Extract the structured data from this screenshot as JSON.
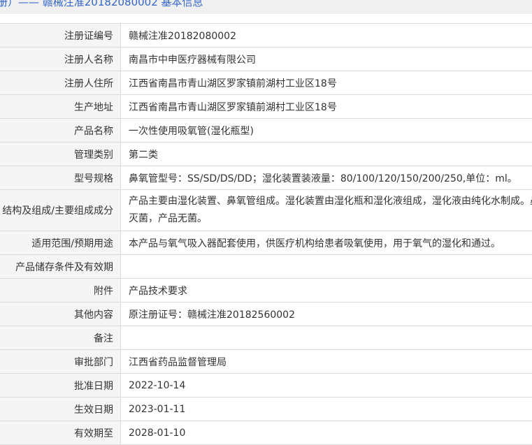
{
  "header": {
    "text": "册）——  赣械注准20182080002  基本信息"
  },
  "rows": [
    {
      "label": "注册证编号",
      "value": "赣械注准20182080002"
    },
    {
      "label": "注册人名称",
      "value": "南昌市中申医疗器械有限公司"
    },
    {
      "label": "注册人住所",
      "value": "江西省南昌市青山湖区罗家镇前湖村工业区18号"
    },
    {
      "label": "生产地址",
      "value": "江西省南昌市青山湖区罗家镇前湖村工业区18号"
    },
    {
      "label": "产品名称",
      "value": "一次性使用吸氧管(湿化瓶型)"
    },
    {
      "label": "管理类别",
      "value": "第二类"
    },
    {
      "label": "型号规格",
      "value": "鼻氧管型号：SS/SD/DS/DD；湿化装置装液量：80/100/120/150/200/250,单位：ml。"
    },
    {
      "label": "结构及组成/主要组成成分",
      "value": "产品主要由湿化装置、鼻氧管组成。湿化装置由湿化瓶和湿化液组成，湿化液由纯化水制成。鼻",
      "value2": "灭菌，产品无菌。"
    },
    {
      "label": "适用范围/预期用途",
      "value": "本产品与氧气吸入器配套使用，供医疗机构给患者吸氧使用，用于氧气的湿化和通过。"
    },
    {
      "label": "产品储存条件及有效期",
      "value": ""
    },
    {
      "label": "附件",
      "value": "产品技术要求"
    },
    {
      "label": "其他内容",
      "value": "原注册证号：赣械注准20182560002"
    },
    {
      "label": "备注",
      "value": ""
    },
    {
      "label": "审批部门",
      "value": "江西省药品监督管理局"
    },
    {
      "label": "批准日期",
      "value": "2022-10-14"
    },
    {
      "label": "生效日期",
      "value": "2023-01-11"
    },
    {
      "label": "有效期至",
      "value": "2028-01-10"
    }
  ]
}
